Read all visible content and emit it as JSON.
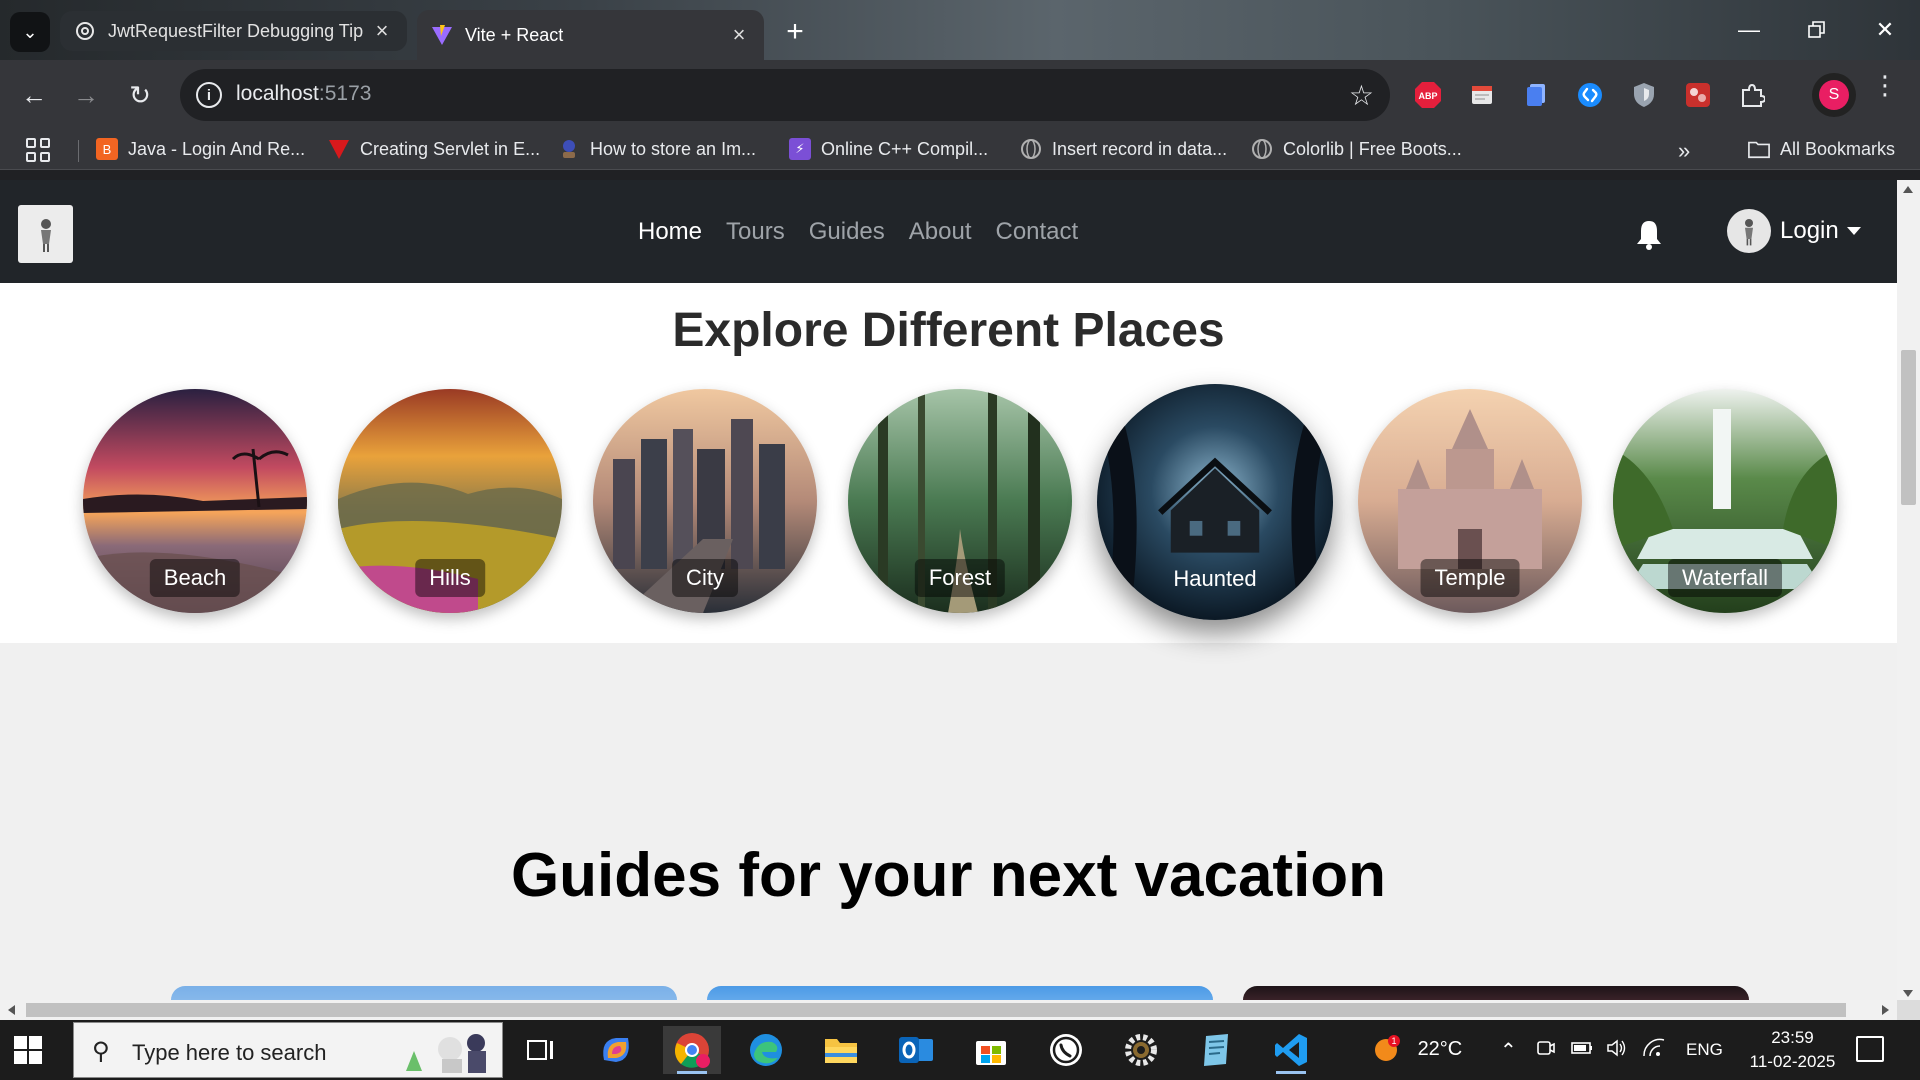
{
  "browser": {
    "tabs": [
      {
        "title": "JwtRequestFilter Debugging Tip",
        "active": false
      },
      {
        "title": "Vite + React",
        "active": true
      }
    ],
    "url_host": "localhost",
    "url_port": ":5173",
    "bookmarks": [
      {
        "label": "Java - Login And Re...",
        "icon": "blogger-icon",
        "color": "#f26522"
      },
      {
        "label": "Creating Servlet in E...",
        "icon": "javatpoint-icon",
        "color": "#d7191c"
      },
      {
        "label": "How to store an Im...",
        "icon": "stackoverflow-icon",
        "color": "#3d4eb8"
      },
      {
        "label": "Online C++ Compil...",
        "icon": "bolt-icon",
        "color": "#7b4fd6"
      },
      {
        "label": "Insert record in data...",
        "icon": "globe-icon",
        "color": "#6d6d6d"
      },
      {
        "label": "Colorlib | Free Boots...",
        "icon": "globe-icon",
        "color": "#6d6d6d"
      }
    ],
    "all_bookmarks": "All Bookmarks",
    "profile_initial": "S",
    "extensions": [
      {
        "name": "adblock-plus-icon",
        "label": "ABP",
        "color": "#e51f3c"
      },
      {
        "name": "notes-extension-icon",
        "label": "",
        "color": "#e0e0e0"
      },
      {
        "name": "docs-extension-icon",
        "label": "",
        "color": "#4a7ff0"
      },
      {
        "name": "shazam-icon",
        "label": "",
        "color": "#1a8cff"
      },
      {
        "name": "shield-extension-icon",
        "label": "",
        "color": "#9aa4b0"
      },
      {
        "name": "puzzle-red-extension-icon",
        "label": "",
        "color": "#c9302c"
      }
    ]
  },
  "site": {
    "nav": {
      "links": [
        "Home",
        "Tours",
        "Guides",
        "About",
        "Contact"
      ],
      "active": "Home",
      "login": "Login"
    },
    "explore_title": "Explore Different Places",
    "places": [
      {
        "label": "Beach",
        "colors": [
          "#2a1e3a",
          "#e8734a",
          "#f6b26b",
          "#5d4a5c"
        ]
      },
      {
        "label": "Hills",
        "colors": [
          "#b24a2e",
          "#e9a23b",
          "#7a8f3a",
          "#c04a8c"
        ]
      },
      {
        "label": "City",
        "colors": [
          "#e7b48c",
          "#7b6a66",
          "#3c3f4a",
          "#2a2f38"
        ]
      },
      {
        "label": "Forest",
        "colors": [
          "#8fae92",
          "#3f6a46",
          "#24412a",
          "#1b2e1e"
        ]
      },
      {
        "label": "Haunted",
        "colors": [
          "#6f9bb4",
          "#1d3c52",
          "#0d1b26",
          "#06101a"
        ]
      },
      {
        "label": "Temple",
        "colors": [
          "#f1c9a5",
          "#cfa58e",
          "#9d7b74",
          "#6d5a5c"
        ]
      },
      {
        "label": "Waterfall",
        "colors": [
          "#f4f6f4",
          "#9cc5b4",
          "#3e7a3a",
          "#233f1c"
        ]
      }
    ],
    "guides_title": "Guides for your next vacation"
  },
  "taskbar": {
    "search_placeholder": "Type here to search",
    "weather": "22°C",
    "language": "ENG",
    "time": "23:59",
    "date": "11-02-2025",
    "weather_badge": "1"
  }
}
